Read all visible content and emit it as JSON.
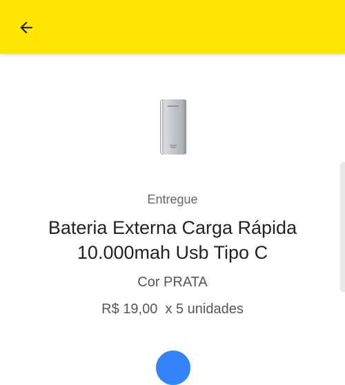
{
  "colors": {
    "header_bg": "#ffe600",
    "accent_blue": "#3483fa",
    "text_primary": "#222222",
    "text_secondary": "#666666"
  },
  "header": {
    "back_icon": "arrow-left-icon"
  },
  "product": {
    "status": "Entregue",
    "title": "Bateria Externa Carga Rápida 10.000mah Usb Tipo C",
    "variation": "Cor PRATA",
    "price": "R$ 19,00",
    "quantity": "x 5 unidades",
    "image_icon": "power-bank-image"
  }
}
